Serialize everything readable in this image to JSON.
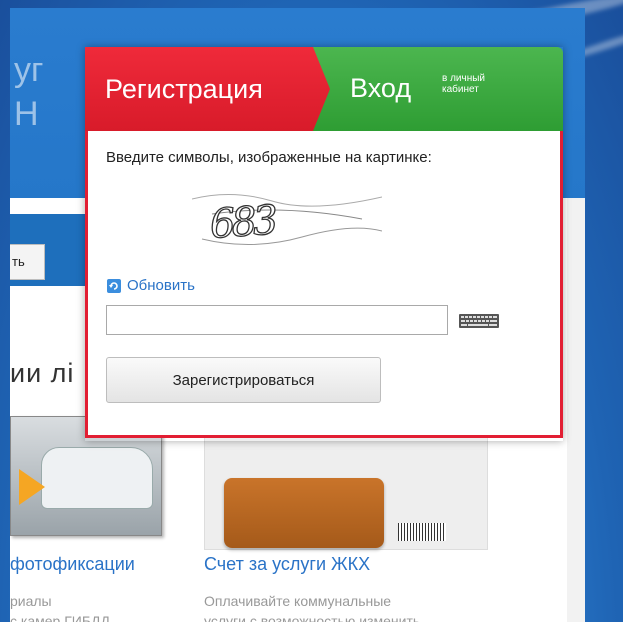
{
  "background": {
    "header_logo_lines": [
      "уг",
      "Н"
    ],
    "search_button_label": "ть",
    "section_title": "ии лі",
    "cards": [
      {
        "title": "фотофиксации",
        "desc_lines": [
          "риалы",
          "с камер ГИБДД"
        ]
      },
      {
        "title": "Счет за услуги ЖКХ",
        "desc_lines": [
          "Оплачивайте коммунальные",
          "услуги с возможностью изменить"
        ]
      }
    ]
  },
  "modal": {
    "tab_register": "Регистрация",
    "tab_login": "Вход",
    "tab_login_sub": [
      "в личный",
      "кабинет"
    ],
    "prompt": "Введите символы, изображенные на картинке:",
    "captcha_text": "683",
    "refresh_label": "Обновить",
    "code_value": "",
    "submit_label": "Зарегистрироваться",
    "colors": {
      "register_tab": "#e21e33",
      "login_tab": "#3aa83e",
      "link": "#2a73c7"
    }
  }
}
